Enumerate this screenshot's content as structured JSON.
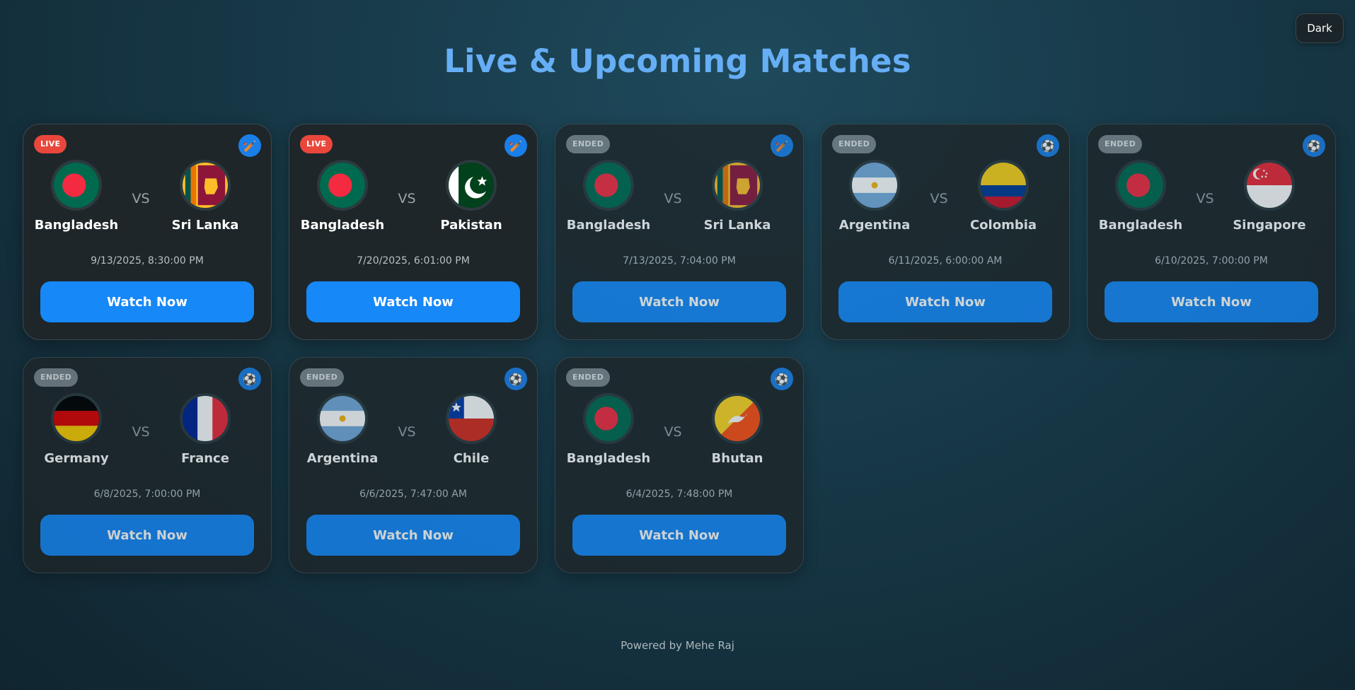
{
  "theme_toggle": {
    "label": "Dark"
  },
  "page_title": "Live & Upcoming Matches",
  "colors": {
    "accent": "#1688f7",
    "title": "#66aef5",
    "live_badge": "#e9473c",
    "ended_badge": "#7d868b"
  },
  "matches": [
    {
      "status": "LIVE",
      "sport_icon": "cricket-icon",
      "team_a": "Bangladesh",
      "team_b": "Sri Lanka",
      "time": "9/13/2025, 8:30:00 PM",
      "button": "Watch Now"
    },
    {
      "status": "LIVE",
      "sport_icon": "cricket-icon",
      "team_a": "Bangladesh",
      "team_b": "Pakistan",
      "time": "7/20/2025, 6:01:00 PM",
      "button": "Watch Now"
    },
    {
      "status": "ENDED",
      "sport_icon": "cricket-icon",
      "team_a": "Bangladesh",
      "team_b": "Sri Lanka",
      "time": "7/13/2025, 7:04:00 PM",
      "button": "Watch Now"
    },
    {
      "status": "ENDED",
      "sport_icon": "football-icon",
      "team_a": "Argentina",
      "team_b": "Colombia",
      "time": "6/11/2025, 6:00:00 AM",
      "button": "Watch Now"
    },
    {
      "status": "ENDED",
      "sport_icon": "football-icon",
      "team_a": "Bangladesh",
      "team_b": "Singapore",
      "time": "6/10/2025, 7:00:00 PM",
      "button": "Watch Now"
    },
    {
      "status": "ENDED",
      "sport_icon": "football-icon",
      "team_a": "Germany",
      "team_b": "France",
      "time": "6/8/2025, 7:00:00 PM",
      "button": "Watch Now"
    },
    {
      "status": "ENDED",
      "sport_icon": "football-icon",
      "team_a": "Argentina",
      "team_b": "Chile",
      "time": "6/6/2025, 7:47:00 AM",
      "button": "Watch Now"
    },
    {
      "status": "ENDED",
      "sport_icon": "football-icon",
      "team_a": "Bangladesh",
      "team_b": "Bhutan",
      "time": "6/4/2025, 7:48:00 PM",
      "button": "Watch Now"
    }
  ],
  "vs_label": "VS",
  "footer": "Powered by Mehe Raj"
}
